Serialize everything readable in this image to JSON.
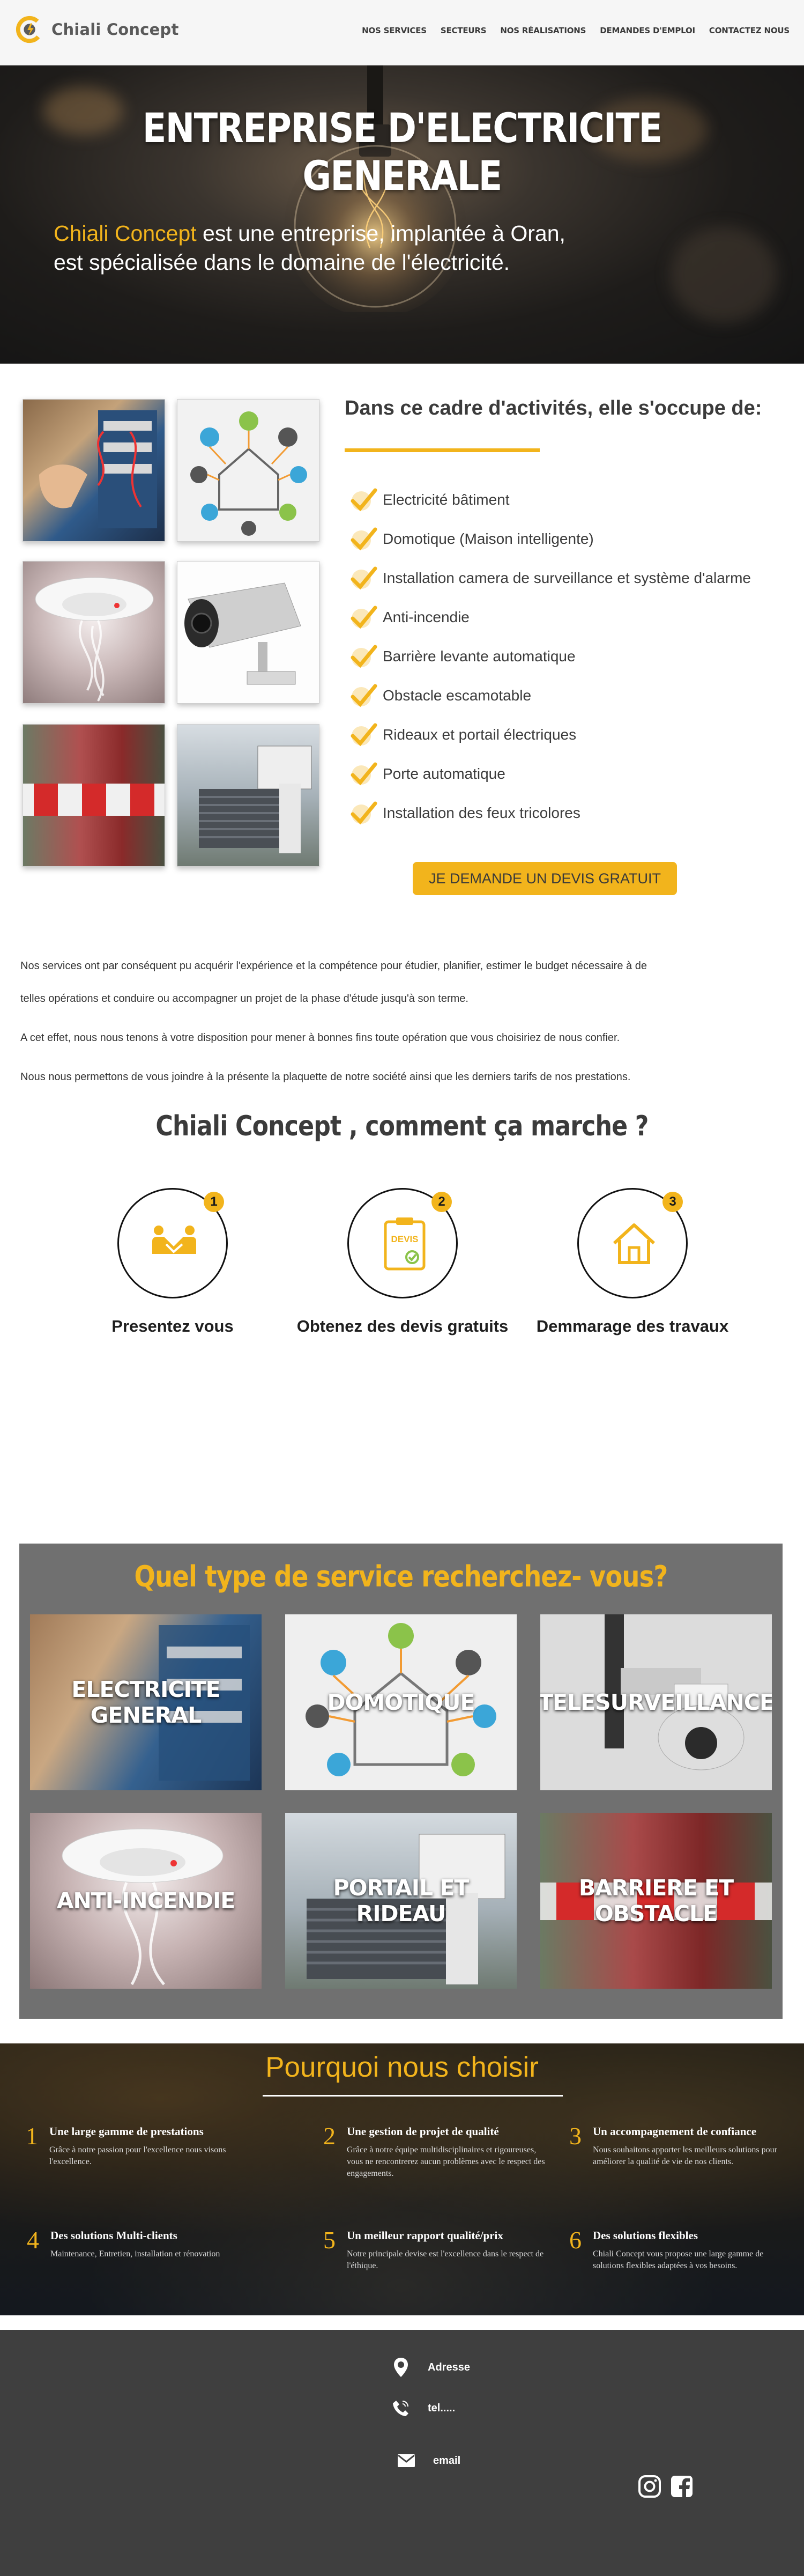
{
  "header": {
    "brand": "Chiali Concept",
    "nav": [
      "NOS SERVICES",
      "SECTEURS",
      "NOS RÉALISATIONS",
      "DEMANDES D'EMPLOI",
      "CONTACTEZ NOUS"
    ]
  },
  "hero": {
    "title": "ENTREPRISE D'ELECTRICITE GENERALE",
    "brand": "Chiali Concept",
    "text_line1_rest": " est une entreprise, implantée à Oran,",
    "text_line2": "est spécialisée dans le domaine de l'électricité."
  },
  "activities": {
    "heading": "Dans ce cadre d'activités, elle s'occupe de:",
    "items": [
      "Electricité bâtiment",
      "Domotique (Maison intelligente)",
      "Installation camera de surveillance et système d'alarme",
      "Anti-incendie",
      "Barrière levante automatique",
      "Obstacle escamotable",
      "Rideaux et portail électriques",
      "Porte automatique",
      "Installation des feux tricolores"
    ],
    "cta": "JE DEMANDE UN DEVIS GRATUIT"
  },
  "intro": {
    "p1a": "Nos services ont par conséquent pu acquérir l'expérience et la compétence pour étudier, planifier, estimer le budget nécessaire à de",
    "p1b": "telles opérations et conduire ou accompagner un projet de la phase d'étude jusqu'à son terme.",
    "p2": "A cet effet, nous nous tenons à votre disposition pour mener à bonnes fins toute opération que vous choisiriez de nous confier.",
    "p3": "Nous nous permettons de vous joindre à la présente la plaquette de notre société ainsi que les derniers tarifs de nos prestations."
  },
  "how": {
    "title": "Chiali Concept , comment ça marche ?",
    "steps": [
      {
        "num": "1",
        "label": "Presentez vous"
      },
      {
        "num": "2",
        "label": "Obtenez des devis gratuits",
        "badge": "DEVIS"
      },
      {
        "num": "3",
        "label": "Demmarage des travaux"
      }
    ]
  },
  "service_types": {
    "title": "Quel type de service recherchez- vous?",
    "tiles": [
      "ELECTRICITE GENERAL",
      "DOMOTIQUE",
      "TELESURVEILLANCE",
      "ANTI-INCENDIE",
      "PORTAIL ET RIDEAU",
      "BARRIERE ET OBSTACLE"
    ]
  },
  "why": {
    "title": "Pourquoi nous choisir",
    "items": [
      {
        "num": "1",
        "head": "Une large gamme de prestations",
        "desc": "Grâce à notre passion pour l'excellence nous visons l'excellence."
      },
      {
        "num": "2",
        "head": "Une gestion de projet de qualité",
        "desc": "Grâce à notre équipe multidisciplinaires et rigoureuses, vous ne rencontrerez aucun problèmes avec le respect des engagements."
      },
      {
        "num": "3",
        "head": "Un accompagnement de confiance",
        "desc": "Nous souhaitons apporter les meilleurs solutions pour améliorer la qualité de vie de nos clients."
      },
      {
        "num": "4",
        "head": "Des solutions Multi-clients",
        "desc": "Maintenance, Entretien, installation et rénovation"
      },
      {
        "num": "5",
        "head": "Un meilleur rapport qualité/prix",
        "desc": "Notre principale devise est l'excellence dans le respect de l'éthique."
      },
      {
        "num": "6",
        "head": "Des solutions flexibles",
        "desc": "Chiali Concept vous propose une large gamme de solutions flexibles adaptées à vos besoins."
      }
    ]
  },
  "footer": {
    "address": "Adresse",
    "phone": "tel.....",
    "email": "email"
  },
  "colors": {
    "accent": "#f2b41c",
    "dark": "#3f3f3f",
    "panel": "#707070"
  }
}
